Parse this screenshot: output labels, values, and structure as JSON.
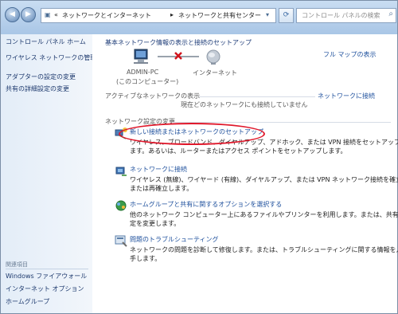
{
  "address_bar": {
    "chevron": "«",
    "crumb1": "ネットワークとインターネット",
    "arrow": "▸",
    "crumb2": "ネットワークと共有センター",
    "search_placeholder": "コントロール パネルの検索"
  },
  "sidebar": {
    "home": "コントロール パネル ホーム",
    "items": [
      "ワイヤレス ネットワークの管理",
      "アダプターの設定の変更",
      "共有の詳細設定の変更"
    ],
    "related_heading": "関連項目",
    "related": [
      "Windows ファイアウォール",
      "インターネット オプション",
      "ホームグループ"
    ]
  },
  "main": {
    "basic_title": "基本ネットワーク情報の表示と接続のセットアップ",
    "full_map": "フル マップの表示",
    "pc_name": "ADMIN-PC",
    "pc_sub": "(このコンピューター)",
    "internet": "インターネット",
    "active_label": "アクティブなネットワークの表示",
    "connect_link": "ネットワークに接続",
    "not_connected": "現在どのネットワークにも接続していません",
    "change_settings": "ネットワーク設定の変更",
    "tasks": [
      {
        "title": "新しい接続またはネットワークのセットアップ",
        "desc1": "ワイヤレス、ブロードバンド、ダイヤルアップ、アドホック、または VPN 接続をセットアップし",
        "desc2": "ます。あるいは、ルーターまたはアクセス ポイントをセットアップします。"
      },
      {
        "title": "ネットワークに接続",
        "desc1": "ワイヤレス (無線)、ワイヤード (有線)、ダイヤルアップ、または VPN ネットワーク接続を確立",
        "desc2": "または再確立します。"
      },
      {
        "title": "ホームグループと共有に関するオプションを選択する",
        "desc1": "他のネットワーク コンピューター上にあるファイルやプリンターを利用します。または、共有設",
        "desc2": "定を変更します。"
      },
      {
        "title": "問題のトラブルシューティング",
        "desc1": "ネットワークの問題を診断して修復します。または、トラブルシューティングに関する情報を入",
        "desc2": "手します。"
      }
    ]
  },
  "colors": {
    "accent": "#1d4f9c",
    "highlight_ellipse": "#e0182b"
  }
}
